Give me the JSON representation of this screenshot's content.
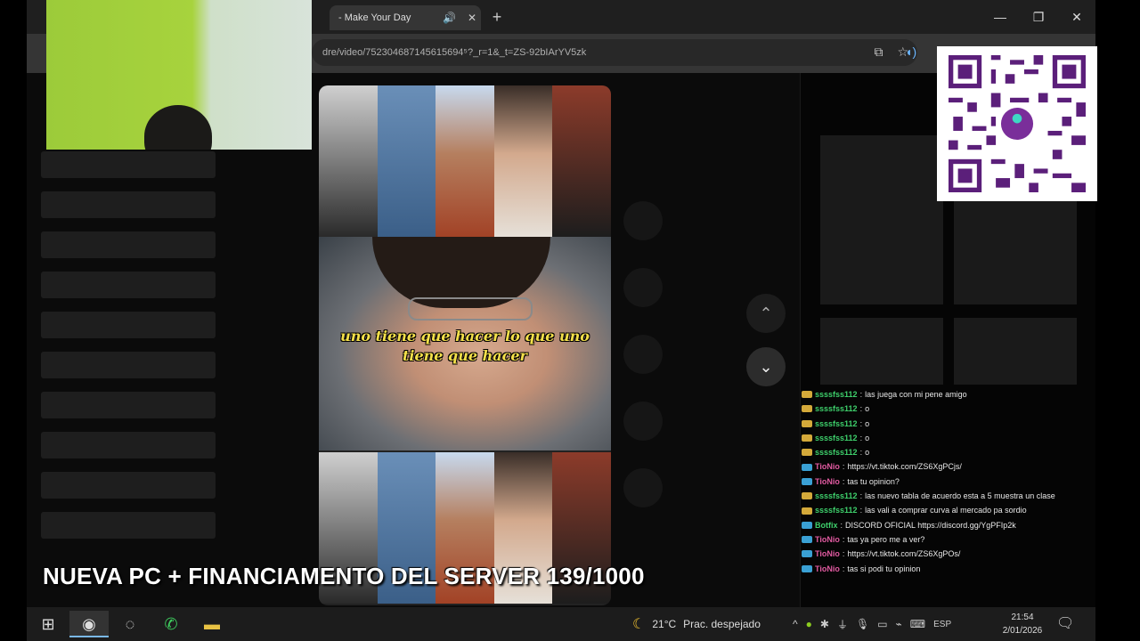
{
  "browser": {
    "tab_title": "- Make Your Day",
    "tab_mute_icon": "speaker-icon",
    "tab_close": "✕",
    "new_tab": "+",
    "url": "dre/video/752304687145615694⁵?_r=1&_t=ZS-92bIArYV5zk",
    "window_controls": {
      "minimize": "—",
      "maximize": "❐",
      "close": "✕"
    }
  },
  "video": {
    "caption_line1": "uno tiene que hacer lo que uno",
    "caption_line2": "tiene que hacer"
  },
  "banner": "NUEVA PC + FINANCIAMENTO DEL SERVER 139/1000",
  "chat": [
    {
      "user": "ssssfss112",
      "color": "#3ecf6b",
      "badge": "gold",
      "msg": "las juega con mi pene amigo"
    },
    {
      "user": "ssssfss112",
      "color": "#3ecf6b",
      "badge": "gold",
      "msg": "o"
    },
    {
      "user": "ssssfss112",
      "color": "#3ecf6b",
      "badge": "gold",
      "msg": "o"
    },
    {
      "user": "ssssfss112",
      "color": "#3ecf6b",
      "badge": "gold",
      "msg": "o"
    },
    {
      "user": "ssssfss112",
      "color": "#3ecf6b",
      "badge": "gold",
      "msg": "o"
    },
    {
      "user": "TioNio",
      "color": "#e05aa0",
      "badge": "blue",
      "msg": "https://vt.tiktok.com/ZS6XgPCjs/"
    },
    {
      "user": "TioNio",
      "color": "#e05aa0",
      "badge": "blue",
      "msg": "tas tu opinion?"
    },
    {
      "user": "ssssfss112",
      "color": "#3ecf6b",
      "badge": "gold",
      "msg": "las nuevo tabla de acuerdo esta a 5 muestra un clase"
    },
    {
      "user": "ssssfss112",
      "color": "#3ecf6b",
      "badge": "gold",
      "msg": "las vali a comprar curva al mercado pa sordio"
    },
    {
      "user": "Botfix",
      "color": "#3ecf6b",
      "badge": "blue",
      "msg": "DISCORD OFICIAL https://discord.gg/YgPFIp2k"
    },
    {
      "user": "TioNio",
      "color": "#e05aa0",
      "badge": "blue",
      "msg": "tas ya pero me a ver?"
    },
    {
      "user": "TioNio",
      "color": "#e05aa0",
      "badge": "blue",
      "msg": "https://vt.tiktok.com/ZS6XgPOs/"
    },
    {
      "user": "TioNio",
      "color": "#e05aa0",
      "badge": "blue",
      "msg": "tas si podi tu opinion"
    }
  ],
  "taskbar": {
    "weather_temp": "21°C",
    "weather_desc": "Prac. despejado",
    "language": "ESP",
    "time": "21:54",
    "date": "2/01/2026"
  }
}
